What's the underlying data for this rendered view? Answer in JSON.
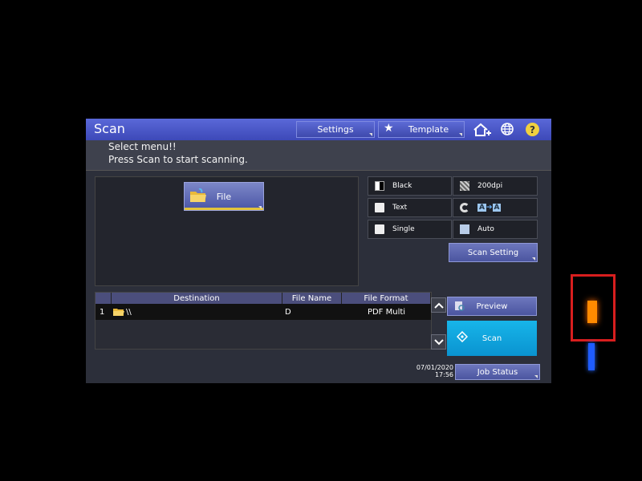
{
  "title": "Scan",
  "header": {
    "settings_label": "Settings",
    "template_label": "Template"
  },
  "messages": [
    "Select menu!!",
    "Press Scan to start scanning."
  ],
  "file_button_label": "File",
  "scan_settings": {
    "color": "Black",
    "resolution": "200dpi",
    "original_mode": "Text",
    "sides": "Single",
    "auto": "Auto",
    "scan_setting_button": "Scan Setting"
  },
  "destination_table": {
    "columns": [
      "Destination",
      "File Name",
      "File Format"
    ],
    "rows": [
      {
        "num": "1",
        "destination": "\\\\",
        "file_name": "D",
        "file_format": "PDF Multi"
      }
    ]
  },
  "preview_label": "Preview",
  "scan_label": "Scan",
  "datetime": {
    "date": "07/01/2020",
    "time": "17:56"
  },
  "job_status_label": "Job Status",
  "colors": {
    "titlebar": "#4a57c8",
    "scan_button": "#12a8e2",
    "led_orange": "#ff8a00",
    "led_blue": "#1f5cff",
    "annotation": "#d81e1e"
  }
}
